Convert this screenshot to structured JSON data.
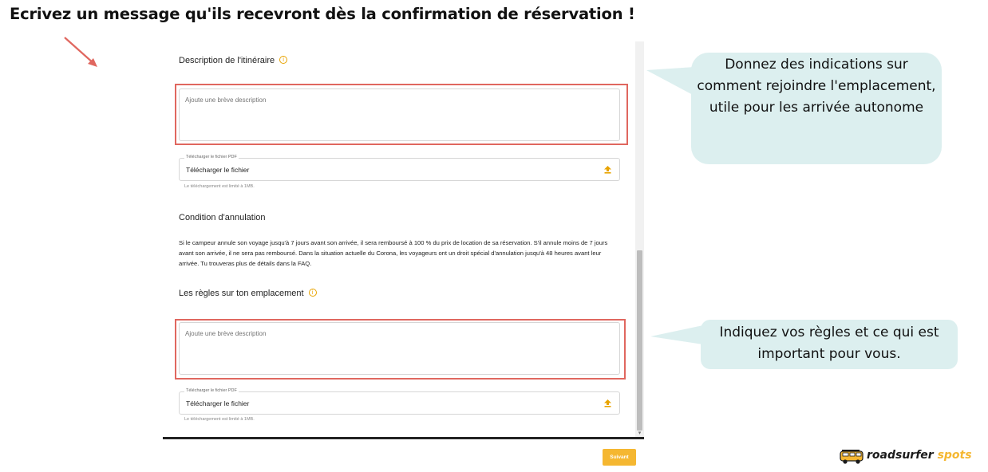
{
  "headline": "Ecrivez un message qu'ils recevront dès la confirmation de réservation !",
  "form": {
    "itinerary": {
      "title": "Description de l'itinéraire",
      "info_icon": "i",
      "placeholder": "Ajoute une brève description",
      "file_legend": "Télécharger le fichier PDF",
      "file_button": "Télécharger le fichier",
      "file_hint": "Le téléchargement est limité à 1MB."
    },
    "cancellation": {
      "title": "Condition d'annulation",
      "text": "Si le campeur annule son voyage jusqu'à 7 jours avant son arrivée, il sera remboursé à 100 % du prix de location de sa réservation. S'il annule moins de 7 jours avant son arrivée, il ne sera pas remboursé. Dans la situation actuelle du Corona, les voyageurs ont un droit spécial d'annulation jusqu'à 48 heures avant leur arrivée. Tu trouveras plus de détails dans la FAQ."
    },
    "rules": {
      "title": "Les règles sur ton emplacement",
      "info_icon": "i",
      "placeholder": "Ajoute une brève description",
      "file_legend": "Télécharger le fichier PDF",
      "file_button": "Télécharger le fichier",
      "file_hint": "Le téléchargement est limité à 1MB."
    },
    "next_button": "Suivant"
  },
  "callouts": {
    "top": "Donnez des indications sur comment rejoindre l'emplacement, utile pour les arrivée autonome",
    "bottom": "Indiquez vos règles et ce qui est important pour vous."
  },
  "logo": {
    "brand": "roadsurfer",
    "suffix": "spots"
  },
  "colors": {
    "highlight": "#e0675f",
    "accent": "#f5b731",
    "bubble": "#dcefef"
  },
  "icons": {
    "arrow": "arrow-down-right-icon",
    "info": "info-icon",
    "upload": "upload-icon",
    "logo_van": "van-icon"
  }
}
